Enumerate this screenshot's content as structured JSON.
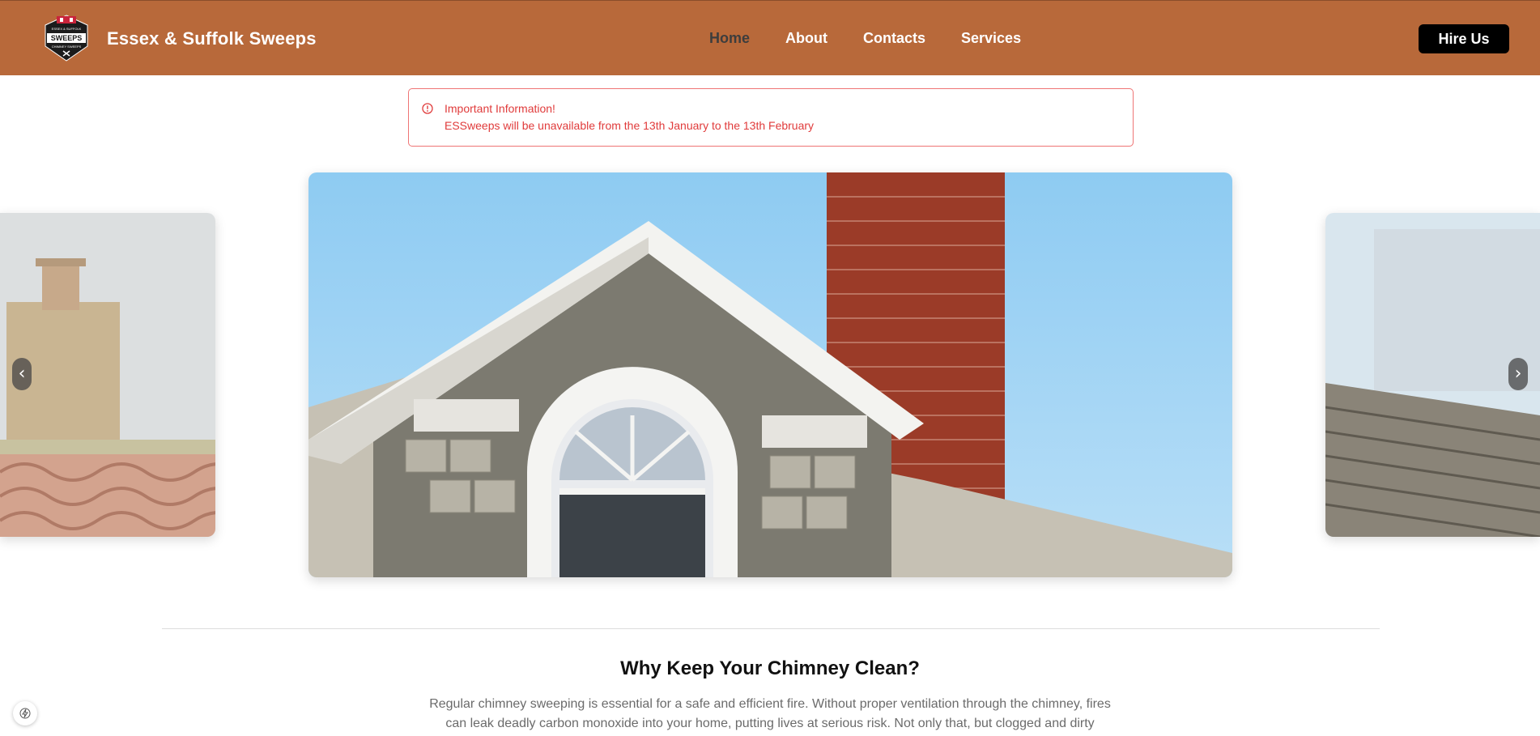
{
  "header": {
    "brand": "Essex & Suffolk Sweeps",
    "logo": {
      "top_text": "ESSEX & SUFFOLK",
      "main_text": "SWEEPS",
      "bottom_text": "CHIMNEY SWEEPS"
    },
    "nav": [
      {
        "label": "Home",
        "active": true
      },
      {
        "label": "About",
        "active": false
      },
      {
        "label": "Contacts",
        "active": false
      },
      {
        "label": "Services",
        "active": false
      }
    ],
    "cta_label": "Hire Us"
  },
  "alert": {
    "icon": "alert-circle-icon",
    "title": "Important Information!",
    "message": "ESSweeps will be unavailable from the 13th January to the 13th February"
  },
  "carousel": {
    "prev_label": "‹",
    "next_label": "›",
    "slides": [
      "chimney-stack-photo",
      "brick-chimney-dormer-photo",
      "roof-tiles-photo"
    ]
  },
  "section": {
    "title": "Why Keep Your Chimney Clean?",
    "body_line1": "Regular chimney sweeping is essential for a safe and efficient fire. Without proper ventilation through the chimney, fires",
    "body_line2": "can leak deadly carbon monoxide into your home, putting lives at serious risk. Not only that, but clogged and dirty"
  },
  "colors": {
    "header_bg": "#b8693a",
    "alert_red": "#e03b3b",
    "cta_bg": "#000000"
  }
}
